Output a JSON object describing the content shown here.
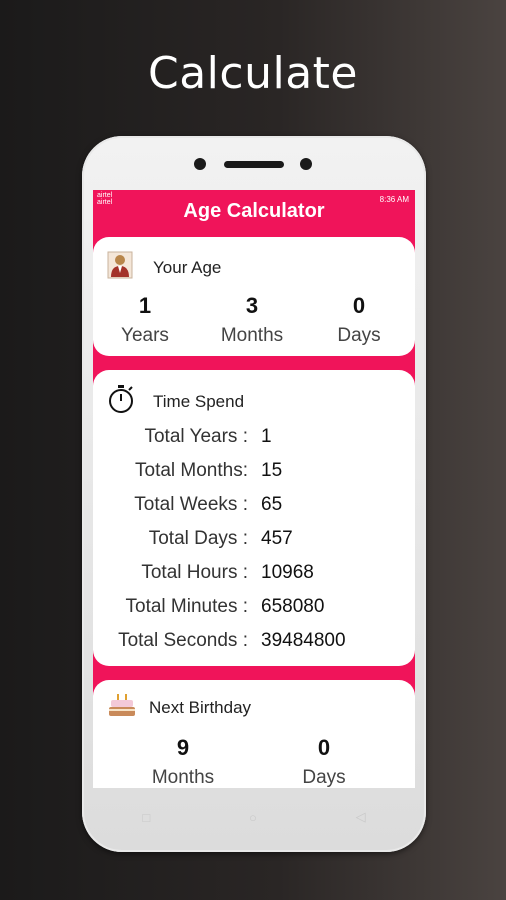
{
  "headline": "Calculate",
  "statusbar": {
    "carrier1": "airtel",
    "carrier2": "airtel",
    "time": "8:36 AM"
  },
  "app": {
    "title": "Age Calculator"
  },
  "your_age": {
    "title": "Your Age",
    "stats": [
      {
        "value": "1",
        "label": "Years"
      },
      {
        "value": "3",
        "label": "Months"
      },
      {
        "value": "0",
        "label": "Days"
      }
    ]
  },
  "time_spend": {
    "title": "Time Spend",
    "rows": [
      {
        "label": "Total Years :",
        "value": "1"
      },
      {
        "label": "Total Months:",
        "value": "15"
      },
      {
        "label": "Total Weeks :",
        "value": "65"
      },
      {
        "label": "Total Days :",
        "value": "457"
      },
      {
        "label": "Total Hours :",
        "value": "10968"
      },
      {
        "label": "Total Minutes :",
        "value": "658080"
      },
      {
        "label": "Total Seconds :",
        "value": "39484800"
      }
    ]
  },
  "next_birthday": {
    "title": "Next Birthday",
    "stats": [
      {
        "value": "9",
        "label": "Months"
      },
      {
        "value": "0",
        "label": "Days"
      }
    ]
  },
  "icons": {
    "person": "person-icon",
    "stopwatch": "stopwatch-icon",
    "cake": "cake-icon"
  },
  "colors": {
    "accent": "#f0145a",
    "card": "#ffffff"
  }
}
